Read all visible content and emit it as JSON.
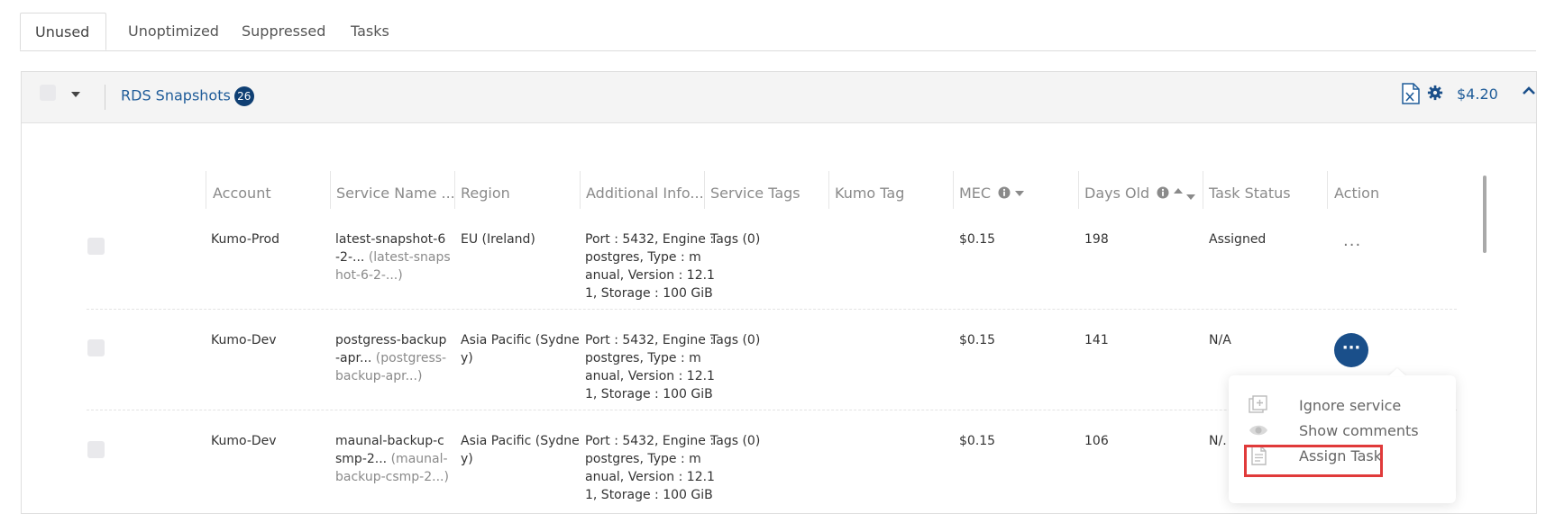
{
  "tabs": [
    "Unused",
    "Unoptimized",
    "Suppressed",
    "Tasks"
  ],
  "panel": {
    "service_name": "RDS Snapshots",
    "count": "26",
    "total_cost": "$4.20"
  },
  "columns": {
    "account": "Account",
    "service_name": "Service Name ...",
    "region": "Region",
    "additional_info": "Additional Info...",
    "service_tags": "Service Tags",
    "kumo_tag": "Kumo Tag",
    "mec": "MEC",
    "days_old": "Days Old",
    "task_status": "Task Status",
    "action": "Action"
  },
  "rows": [
    {
      "account": "Kumo-Prod",
      "name_l1": "latest-snapshot-6",
      "name_l2": "-2-...",
      "name_l2_muted": " (latest-snaps",
      "name_l3": "hot-6-2-...)",
      "region_l1": "EU (Ireland)",
      "region_l2": "",
      "info": [
        "Port : 5432, Engine :",
        "postgres, Type : m",
        "anual, Version : 12.1",
        "1, Storage : 100 GiB"
      ],
      "tags": "Tags (0)",
      "mec": "$0.15",
      "days": "198",
      "status": "Assigned"
    },
    {
      "account": "Kumo-Dev",
      "name_l1": "postgress-backup",
      "name_l2": "-apr...",
      "name_l2_muted": " (postgress-",
      "name_l3": "backup-apr...)",
      "region_l1": "Asia Pacific (Sydne",
      "region_l2": "y)",
      "info": [
        "Port : 5432, Engine :",
        "postgres, Type : m",
        "anual, Version : 12.1",
        "1, Storage : 100 GiB"
      ],
      "tags": "Tags (0)",
      "mec": "$0.15",
      "days": "141",
      "status": "N/A"
    },
    {
      "account": "Kumo-Dev",
      "name_l1": "maunal-backup-c",
      "name_l2": "smp-2...",
      "name_l2_muted": " (maunal-",
      "name_l3": "backup-csmp-2...)",
      "region_l1": "Asia Pacific (Sydne",
      "region_l2": "y)",
      "info": [
        "Port : 5432, Engine :",
        "postgres, Type : m",
        "anual, Version : 12.1",
        "1, Storage : 100 GiB"
      ],
      "tags": "Tags (0)",
      "mec": "$0.15",
      "days": "106",
      "status": "N/."
    }
  ],
  "menu": {
    "ignore": "Ignore service",
    "comments": "Show comments",
    "assign": "Assign Task"
  },
  "colors": {
    "accent": "#1f5c99",
    "badge": "#0f3f73",
    "highlight": "#e03a3a"
  }
}
